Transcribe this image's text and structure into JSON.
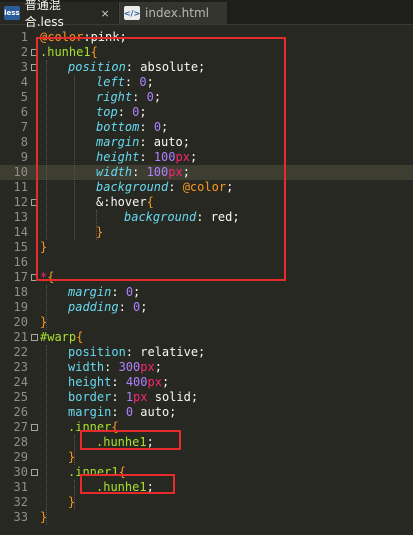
{
  "tabs": [
    {
      "icon": "less",
      "label": "普通混合.less",
      "close": "×",
      "active": true
    },
    {
      "icon": "html",
      "label": "index.html",
      "active": false
    }
  ],
  "icon_texts": {
    "less": "less",
    "html": "</>"
  },
  "highlight_line": 10,
  "lines": [
    {
      "n": "1",
      "fold": false,
      "indent": 0,
      "tokens": [
        [
          "c-var",
          "@color"
        ],
        [
          "code",
          ":pink;"
        ]
      ]
    },
    {
      "n": "2",
      "fold": true,
      "indent": 0,
      "tokens": [
        [
          "c-sel",
          ".hunhe1"
        ],
        [
          "c-brace",
          "{"
        ]
      ]
    },
    {
      "n": "3",
      "fold": true,
      "indent": 1,
      "tokens": [
        [
          "c-prop",
          "position"
        ],
        [
          "code",
          ": absolute;"
        ]
      ]
    },
    {
      "n": "4",
      "fold": false,
      "indent": 2,
      "tokens": [
        [
          "c-prop",
          "left"
        ],
        [
          "code",
          ": "
        ],
        [
          "c-num",
          "0"
        ],
        [
          "code",
          ";"
        ]
      ]
    },
    {
      "n": "5",
      "fold": false,
      "indent": 2,
      "tokens": [
        [
          "c-prop",
          "right"
        ],
        [
          "code",
          ": "
        ],
        [
          "c-num",
          "0"
        ],
        [
          "code",
          ";"
        ]
      ]
    },
    {
      "n": "6",
      "fold": false,
      "indent": 2,
      "tokens": [
        [
          "c-prop",
          "top"
        ],
        [
          "code",
          ": "
        ],
        [
          "c-num",
          "0"
        ],
        [
          "code",
          ";"
        ]
      ]
    },
    {
      "n": "7",
      "fold": false,
      "indent": 2,
      "tokens": [
        [
          "c-prop",
          "bottom"
        ],
        [
          "code",
          ": "
        ],
        [
          "c-num",
          "0"
        ],
        [
          "code",
          ";"
        ]
      ]
    },
    {
      "n": "8",
      "fold": false,
      "indent": 2,
      "tokens": [
        [
          "c-prop",
          "margin"
        ],
        [
          "code",
          ": auto;"
        ]
      ]
    },
    {
      "n": "9",
      "fold": false,
      "indent": 2,
      "tokens": [
        [
          "c-prop",
          "height"
        ],
        [
          "code",
          ": "
        ],
        [
          "c-num",
          "100"
        ],
        [
          "c-unit",
          "px"
        ],
        [
          "code",
          ";"
        ]
      ]
    },
    {
      "n": "10",
      "fold": false,
      "indent": 2,
      "tokens": [
        [
          "c-prop",
          "width"
        ],
        [
          "code",
          ": "
        ],
        [
          "c-num",
          "100"
        ],
        [
          "c-unit",
          "px"
        ],
        [
          "code",
          ";"
        ]
      ]
    },
    {
      "n": "11",
      "fold": false,
      "indent": 2,
      "tokens": [
        [
          "c-prop",
          "background"
        ],
        [
          "code",
          ": "
        ],
        [
          "c-atvar",
          "@color"
        ],
        [
          "code",
          ";"
        ]
      ]
    },
    {
      "n": "12",
      "fold": true,
      "indent": 2,
      "tokens": [
        [
          "code",
          "&:hover"
        ],
        [
          "c-brace",
          "{"
        ]
      ]
    },
    {
      "n": "13",
      "fold": false,
      "indent": 3,
      "tokens": [
        [
          "c-prop",
          "background"
        ],
        [
          "code",
          ": red;"
        ]
      ]
    },
    {
      "n": "14",
      "fold": false,
      "indent": 2,
      "tokens": [
        [
          "c-brace",
          "}"
        ]
      ]
    },
    {
      "n": "15",
      "fold": false,
      "indent": 0,
      "tokens": [
        [
          "c-brace",
          "}"
        ]
      ]
    },
    {
      "n": "16",
      "fold": false,
      "indent": 0,
      "tokens": []
    },
    {
      "n": "17",
      "fold": true,
      "indent": 0,
      "tokens": [
        [
          "c-star",
          "*"
        ],
        [
          "c-brace",
          "{"
        ]
      ]
    },
    {
      "n": "18",
      "fold": false,
      "indent": 1,
      "tokens": [
        [
          "c-prop",
          "margin"
        ],
        [
          "code",
          ": "
        ],
        [
          "c-num",
          "0"
        ],
        [
          "code",
          ";"
        ]
      ]
    },
    {
      "n": "19",
      "fold": false,
      "indent": 1,
      "tokens": [
        [
          "c-prop",
          "padding"
        ],
        [
          "code",
          ": "
        ],
        [
          "c-num",
          "0"
        ],
        [
          "code",
          ";"
        ]
      ]
    },
    {
      "n": "20",
      "fold": false,
      "indent": 0,
      "tokens": [
        [
          "c-brace",
          "}"
        ]
      ]
    },
    {
      "n": "21",
      "fold": true,
      "indent": 0,
      "tokens": [
        [
          "c-sel",
          "#warp"
        ],
        [
          "c-brace",
          "{"
        ]
      ]
    },
    {
      "n": "22",
      "fold": false,
      "indent": 1,
      "tokens": [
        [
          "c-kw",
          "position"
        ],
        [
          "code",
          ": relative;"
        ]
      ]
    },
    {
      "n": "23",
      "fold": false,
      "indent": 1,
      "tokens": [
        [
          "c-kw",
          "width"
        ],
        [
          "code",
          ": "
        ],
        [
          "c-num",
          "300"
        ],
        [
          "c-unit",
          "px"
        ],
        [
          "code",
          ";"
        ]
      ]
    },
    {
      "n": "24",
      "fold": false,
      "indent": 1,
      "tokens": [
        [
          "c-kw",
          "height"
        ],
        [
          "code",
          ": "
        ],
        [
          "c-num",
          "400"
        ],
        [
          "c-unit",
          "px"
        ],
        [
          "code",
          ";"
        ]
      ]
    },
    {
      "n": "25",
      "fold": false,
      "indent": 1,
      "tokens": [
        [
          "c-kw",
          "border"
        ],
        [
          "code",
          ": "
        ],
        [
          "c-num",
          "1"
        ],
        [
          "c-unit",
          "px"
        ],
        [
          "code",
          " solid;"
        ]
      ]
    },
    {
      "n": "26",
      "fold": false,
      "indent": 1,
      "tokens": [
        [
          "c-kw",
          "margin"
        ],
        [
          "code",
          ": "
        ],
        [
          "c-num",
          "0"
        ],
        [
          "code",
          " auto;"
        ]
      ]
    },
    {
      "n": "27",
      "fold": true,
      "indent": 1,
      "tokens": [
        [
          "c-sel",
          ".inner"
        ],
        [
          "c-brace",
          "{"
        ]
      ]
    },
    {
      "n": "28",
      "fold": false,
      "indent": 2,
      "tokens": [
        [
          "c-sel",
          ".hunhe1"
        ],
        [
          "code",
          ";"
        ]
      ]
    },
    {
      "n": "29",
      "fold": false,
      "indent": 1,
      "tokens": [
        [
          "c-brace",
          "}"
        ]
      ]
    },
    {
      "n": "30",
      "fold": true,
      "indent": 1,
      "tokens": [
        [
          "c-sel",
          ".inner1"
        ],
        [
          "c-brace",
          "{"
        ]
      ]
    },
    {
      "n": "31",
      "fold": false,
      "indent": 2,
      "tokens": [
        [
          "c-sel",
          ".hunhe1"
        ],
        [
          "code",
          ";"
        ]
      ]
    },
    {
      "n": "32",
      "fold": false,
      "indent": 1,
      "tokens": [
        [
          "c-brace",
          "}"
        ]
      ]
    },
    {
      "n": "33",
      "fold": false,
      "indent": 0,
      "tokens": [
        [
          "c-brace",
          "}"
        ]
      ]
    }
  ]
}
